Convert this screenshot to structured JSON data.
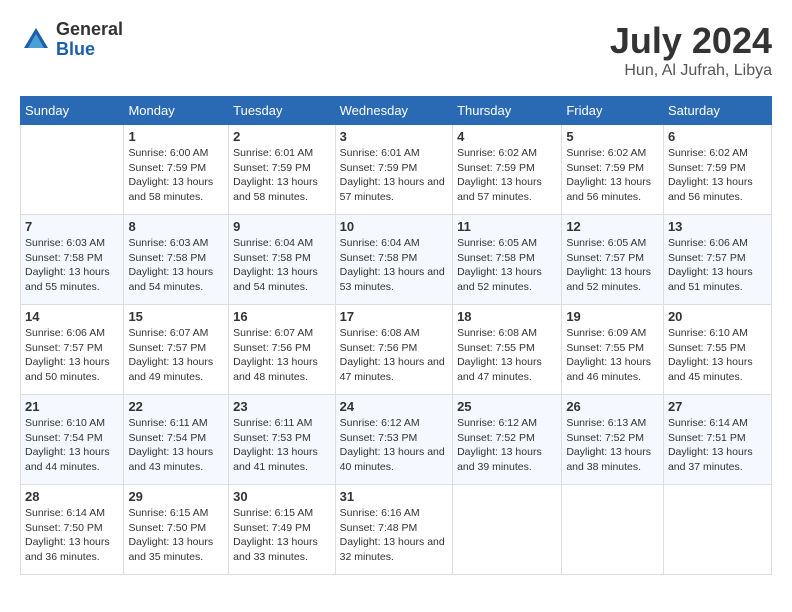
{
  "header": {
    "logo_general": "General",
    "logo_blue": "Blue",
    "month_year": "July 2024",
    "location": "Hun, Al Jufrah, Libya"
  },
  "days_of_week": [
    "Sunday",
    "Monday",
    "Tuesday",
    "Wednesday",
    "Thursday",
    "Friday",
    "Saturday"
  ],
  "weeks": [
    [
      {
        "day": "",
        "sunrise": "",
        "sunset": "",
        "daylight": ""
      },
      {
        "day": "1",
        "sunrise": "Sunrise: 6:00 AM",
        "sunset": "Sunset: 7:59 PM",
        "daylight": "Daylight: 13 hours and 58 minutes."
      },
      {
        "day": "2",
        "sunrise": "Sunrise: 6:01 AM",
        "sunset": "Sunset: 7:59 PM",
        "daylight": "Daylight: 13 hours and 58 minutes."
      },
      {
        "day": "3",
        "sunrise": "Sunrise: 6:01 AM",
        "sunset": "Sunset: 7:59 PM",
        "daylight": "Daylight: 13 hours and 57 minutes."
      },
      {
        "day": "4",
        "sunrise": "Sunrise: 6:02 AM",
        "sunset": "Sunset: 7:59 PM",
        "daylight": "Daylight: 13 hours and 57 minutes."
      },
      {
        "day": "5",
        "sunrise": "Sunrise: 6:02 AM",
        "sunset": "Sunset: 7:59 PM",
        "daylight": "Daylight: 13 hours and 56 minutes."
      },
      {
        "day": "6",
        "sunrise": "Sunrise: 6:02 AM",
        "sunset": "Sunset: 7:59 PM",
        "daylight": "Daylight: 13 hours and 56 minutes."
      }
    ],
    [
      {
        "day": "7",
        "sunrise": "Sunrise: 6:03 AM",
        "sunset": "Sunset: 7:58 PM",
        "daylight": "Daylight: 13 hours and 55 minutes."
      },
      {
        "day": "8",
        "sunrise": "Sunrise: 6:03 AM",
        "sunset": "Sunset: 7:58 PM",
        "daylight": "Daylight: 13 hours and 54 minutes."
      },
      {
        "day": "9",
        "sunrise": "Sunrise: 6:04 AM",
        "sunset": "Sunset: 7:58 PM",
        "daylight": "Daylight: 13 hours and 54 minutes."
      },
      {
        "day": "10",
        "sunrise": "Sunrise: 6:04 AM",
        "sunset": "Sunset: 7:58 PM",
        "daylight": "Daylight: 13 hours and 53 minutes."
      },
      {
        "day": "11",
        "sunrise": "Sunrise: 6:05 AM",
        "sunset": "Sunset: 7:58 PM",
        "daylight": "Daylight: 13 hours and 52 minutes."
      },
      {
        "day": "12",
        "sunrise": "Sunrise: 6:05 AM",
        "sunset": "Sunset: 7:57 PM",
        "daylight": "Daylight: 13 hours and 52 minutes."
      },
      {
        "day": "13",
        "sunrise": "Sunrise: 6:06 AM",
        "sunset": "Sunset: 7:57 PM",
        "daylight": "Daylight: 13 hours and 51 minutes."
      }
    ],
    [
      {
        "day": "14",
        "sunrise": "Sunrise: 6:06 AM",
        "sunset": "Sunset: 7:57 PM",
        "daylight": "Daylight: 13 hours and 50 minutes."
      },
      {
        "day": "15",
        "sunrise": "Sunrise: 6:07 AM",
        "sunset": "Sunset: 7:57 PM",
        "daylight": "Daylight: 13 hours and 49 minutes."
      },
      {
        "day": "16",
        "sunrise": "Sunrise: 6:07 AM",
        "sunset": "Sunset: 7:56 PM",
        "daylight": "Daylight: 13 hours and 48 minutes."
      },
      {
        "day": "17",
        "sunrise": "Sunrise: 6:08 AM",
        "sunset": "Sunset: 7:56 PM",
        "daylight": "Daylight: 13 hours and 47 minutes."
      },
      {
        "day": "18",
        "sunrise": "Sunrise: 6:08 AM",
        "sunset": "Sunset: 7:55 PM",
        "daylight": "Daylight: 13 hours and 47 minutes."
      },
      {
        "day": "19",
        "sunrise": "Sunrise: 6:09 AM",
        "sunset": "Sunset: 7:55 PM",
        "daylight": "Daylight: 13 hours and 46 minutes."
      },
      {
        "day": "20",
        "sunrise": "Sunrise: 6:10 AM",
        "sunset": "Sunset: 7:55 PM",
        "daylight": "Daylight: 13 hours and 45 minutes."
      }
    ],
    [
      {
        "day": "21",
        "sunrise": "Sunrise: 6:10 AM",
        "sunset": "Sunset: 7:54 PM",
        "daylight": "Daylight: 13 hours and 44 minutes."
      },
      {
        "day": "22",
        "sunrise": "Sunrise: 6:11 AM",
        "sunset": "Sunset: 7:54 PM",
        "daylight": "Daylight: 13 hours and 43 minutes."
      },
      {
        "day": "23",
        "sunrise": "Sunrise: 6:11 AM",
        "sunset": "Sunset: 7:53 PM",
        "daylight": "Daylight: 13 hours and 41 minutes."
      },
      {
        "day": "24",
        "sunrise": "Sunrise: 6:12 AM",
        "sunset": "Sunset: 7:53 PM",
        "daylight": "Daylight: 13 hours and 40 minutes."
      },
      {
        "day": "25",
        "sunrise": "Sunrise: 6:12 AM",
        "sunset": "Sunset: 7:52 PM",
        "daylight": "Daylight: 13 hours and 39 minutes."
      },
      {
        "day": "26",
        "sunrise": "Sunrise: 6:13 AM",
        "sunset": "Sunset: 7:52 PM",
        "daylight": "Daylight: 13 hours and 38 minutes."
      },
      {
        "day": "27",
        "sunrise": "Sunrise: 6:14 AM",
        "sunset": "Sunset: 7:51 PM",
        "daylight": "Daylight: 13 hours and 37 minutes."
      }
    ],
    [
      {
        "day": "28",
        "sunrise": "Sunrise: 6:14 AM",
        "sunset": "Sunset: 7:50 PM",
        "daylight": "Daylight: 13 hours and 36 minutes."
      },
      {
        "day": "29",
        "sunrise": "Sunrise: 6:15 AM",
        "sunset": "Sunset: 7:50 PM",
        "daylight": "Daylight: 13 hours and 35 minutes."
      },
      {
        "day": "30",
        "sunrise": "Sunrise: 6:15 AM",
        "sunset": "Sunset: 7:49 PM",
        "daylight": "Daylight: 13 hours and 33 minutes."
      },
      {
        "day": "31",
        "sunrise": "Sunrise: 6:16 AM",
        "sunset": "Sunset: 7:48 PM",
        "daylight": "Daylight: 13 hours and 32 minutes."
      },
      {
        "day": "",
        "sunrise": "",
        "sunset": "",
        "daylight": ""
      },
      {
        "day": "",
        "sunrise": "",
        "sunset": "",
        "daylight": ""
      },
      {
        "day": "",
        "sunrise": "",
        "sunset": "",
        "daylight": ""
      }
    ]
  ]
}
